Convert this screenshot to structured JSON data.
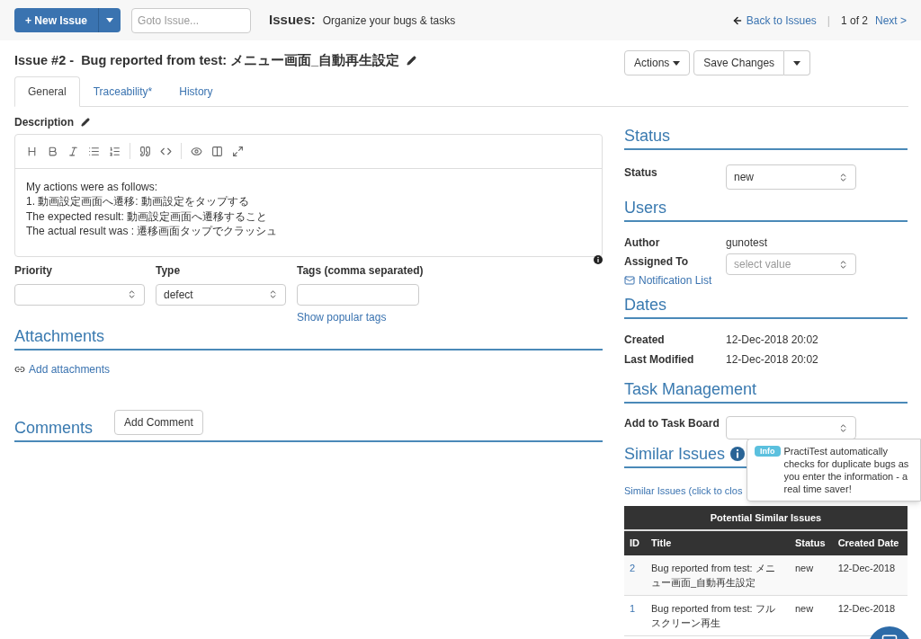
{
  "top_bar": {
    "new_issue_button": "+ New Issue",
    "goto_placeholder": "Goto Issue...",
    "title": "Issues:",
    "subtitle": "Organize your bugs & tasks",
    "back_link": "Back to Issues",
    "separator": "|",
    "pager": "1 of 2",
    "next_link": "Next >"
  },
  "issue_title": "Issue #2 -  Bug reported from test: メニュー画面_自動再生設定",
  "header_buttons": {
    "actions": "Actions",
    "save": "Save Changes"
  },
  "tabs": [
    {
      "label": "General",
      "selected": true
    },
    {
      "label": "Traceability*",
      "selected": false
    },
    {
      "label": "History",
      "selected": false
    }
  ],
  "description": {
    "label": "Description",
    "lines": [
      "My actions were as follows:",
      "1. 動画設定画面へ遷移: 動画設定をタップする",
      "The expected result: 動画設定画面へ遷移すること",
      "The actual result was : 遷移画面タップでクラッシュ"
    ]
  },
  "fields": [
    {
      "kind": "select",
      "label": "Priority"
    },
    {
      "kind": "select",
      "label": "Type",
      "value": "defect"
    },
    {
      "kind": "text",
      "label": "Tags (comma separated)",
      "link": "Show popular tags"
    }
  ],
  "attachments": {
    "heading": "Attachments",
    "link": "Add attachments"
  },
  "comments": {
    "heading": "Comments",
    "button": "Add Comment"
  },
  "status": {
    "heading": "Status",
    "label": "Status",
    "value": "new"
  },
  "users": {
    "heading": "Users",
    "author_label": "Author",
    "author": "gunotest",
    "assigned_label": "Assigned To",
    "assigned_placeholder": "select value",
    "notification_link": "Notification List"
  },
  "dates": {
    "heading": "Dates",
    "rows": [
      {
        "label": "Created",
        "value": "12-Dec-2018 20:02"
      },
      {
        "label": "Last Modified",
        "value": "12-Dec-2018 20:02"
      }
    ]
  },
  "task_management": {
    "heading": "Task Management",
    "label": "Add to Task Board"
  },
  "similar_issues": {
    "heading": "Similar Issues",
    "link": "Similar Issues (click to clos",
    "caption": "Potential Similar Issues",
    "columns": [
      "ID",
      "Title",
      "Status",
      "Created Date"
    ],
    "rows": [
      {
        "id": "2",
        "title": "Bug reported from test: メニュー画面_自動再生設定",
        "status": "new",
        "created": "12-Dec-2018"
      },
      {
        "id": "1",
        "title": "Bug reported from test: フルスクリーン再生",
        "status": "new",
        "created": "12-Dec-2018"
      }
    ]
  },
  "popover": {
    "badge": "Info",
    "text": "PractiTest automatically checks for duplicate bugs as you enter the information - a real time saver!"
  }
}
